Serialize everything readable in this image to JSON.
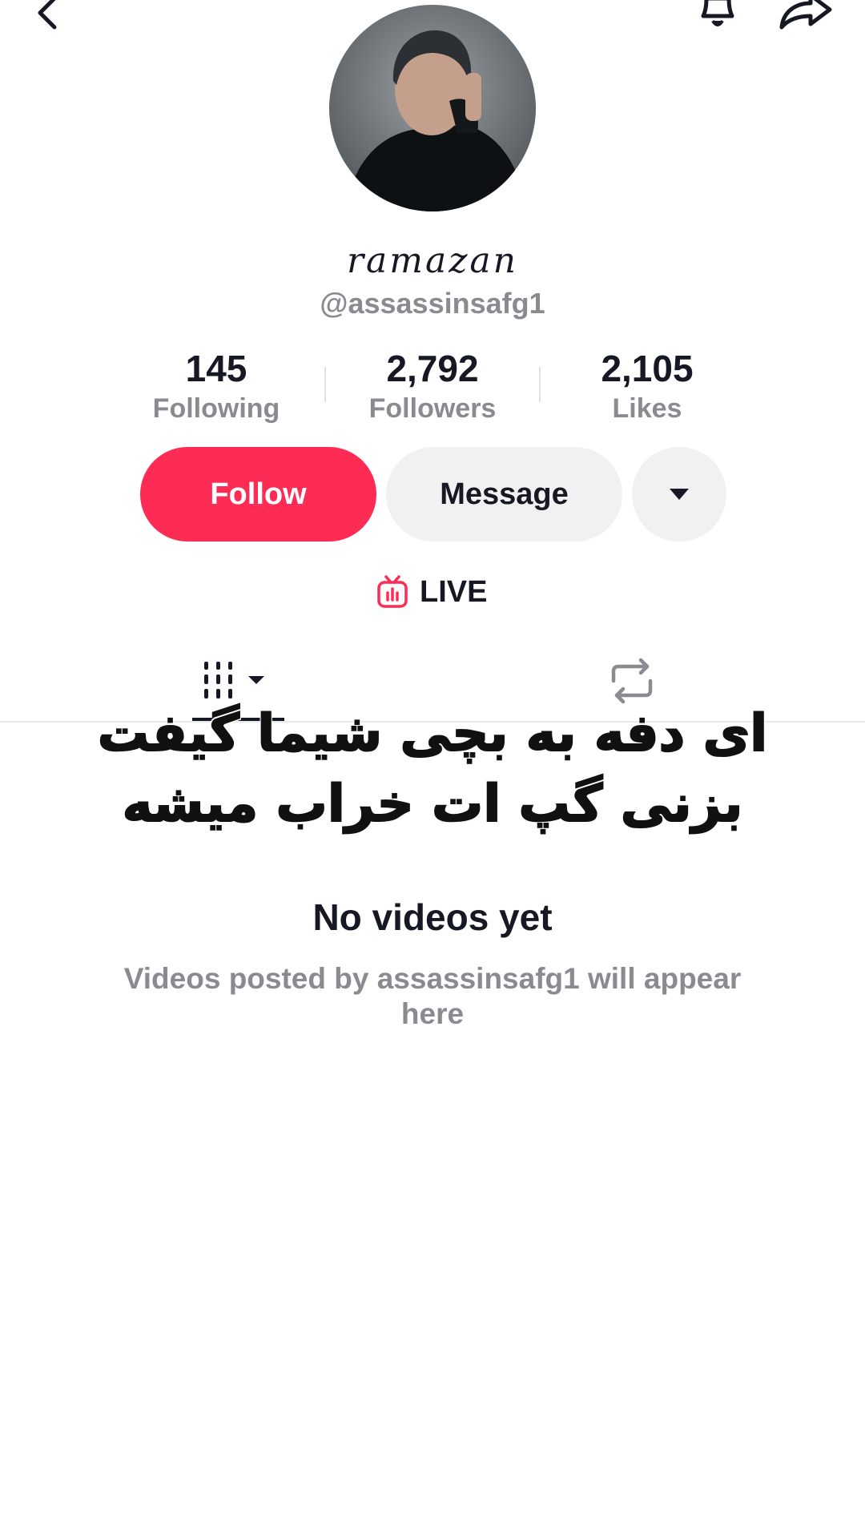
{
  "header": {
    "back_icon": "chevron-left-icon",
    "bell_icon": "bell-icon",
    "share_icon": "share-arrow-icon"
  },
  "profile": {
    "display_name": "ramazan",
    "username": "@assassinsafg1"
  },
  "stats": [
    {
      "value": "145",
      "label": "Following"
    },
    {
      "value": "2,792",
      "label": "Followers"
    },
    {
      "value": "2,105",
      "label": "Likes"
    }
  ],
  "actions": {
    "follow_label": "Follow",
    "message_label": "Message",
    "more_icon": "caret-down-icon"
  },
  "live": {
    "label": "LIVE",
    "icon": "live-tv-icon"
  },
  "tabs": {
    "videos_icon": "grid-videos-icon",
    "reposts_icon": "repost-icon"
  },
  "overlay_caption": "ای دفه به بچی شیما گیفت بزنی گپ ات خراب میشه",
  "empty_state": {
    "title": "No videos yet",
    "description": "Videos posted by assassinsafg1 will appear here"
  },
  "colors": {
    "accent": "#fe2c55",
    "muted_text": "#8a8b91",
    "button_bg": "#f1f1f2"
  }
}
